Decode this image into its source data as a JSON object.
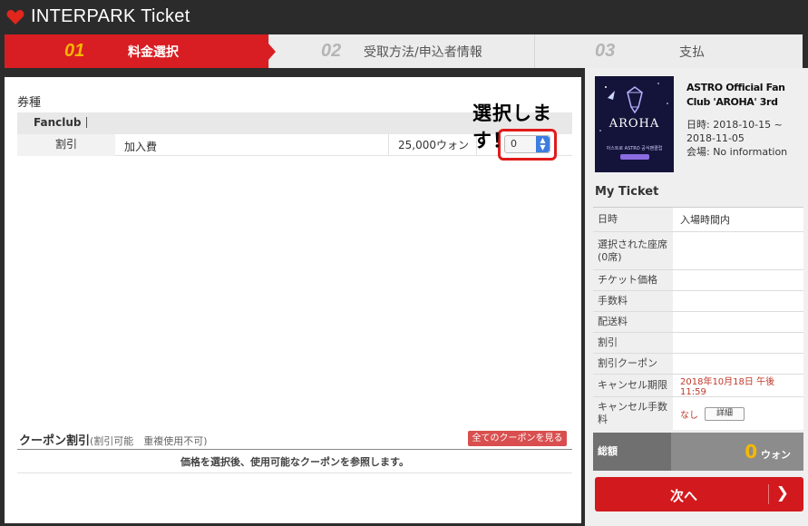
{
  "header": {
    "brand": "INTERPARK",
    "product": "Ticket",
    "heart_color": "#e1261c"
  },
  "steps": [
    {
      "num": "01",
      "label": "料金選択",
      "active": true
    },
    {
      "num": "02",
      "label": "受取方法/申込者情報",
      "active": false
    },
    {
      "num": "03",
      "label": "支払",
      "active": false
    }
  ],
  "ticket_type": {
    "title": "券種",
    "group": "Fanclub",
    "row": {
      "category": "割引",
      "name": "加入費",
      "price": "25,000ウォン",
      "quantity": "0"
    },
    "callout": "選択します！"
  },
  "coupon": {
    "title": "クーポン割引",
    "subtitle": "(割引可能　重複使用不可)",
    "button": "全てのクーポンを見る",
    "message": "価格を選択後、使用可能なクーポンを参照します。"
  },
  "event": {
    "poster_logo": "AROHA",
    "poster_sub": "아스트로 ASTRO 공식팬클럽",
    "title": "ASTRO Official Fan Club 'AROHA' 3rd",
    "date_label": "日時: 2018-10-15 ~ 2018-11-05",
    "venue_label": "会場: No information"
  },
  "my_ticket": {
    "title": "My Ticket",
    "rows": [
      {
        "key": "日時",
        "value": "入場時間内"
      },
      {
        "key": "選択された座席(0席)",
        "value": ""
      },
      {
        "key": "チケット価格",
        "value": ""
      },
      {
        "key": "手数料",
        "value": ""
      },
      {
        "key": "配送料",
        "value": ""
      },
      {
        "key": "割引",
        "value": ""
      },
      {
        "key": "割引クーポン",
        "value": ""
      },
      {
        "key": "キャンセル期限",
        "value": "2018年10月18日 午後 11:59"
      },
      {
        "key": "キャンセル手数料",
        "value": "なし",
        "button": "詳細"
      }
    ],
    "total_label": "総額",
    "total_amount": "0",
    "total_unit": "ウォン",
    "next_button": "次へ"
  }
}
